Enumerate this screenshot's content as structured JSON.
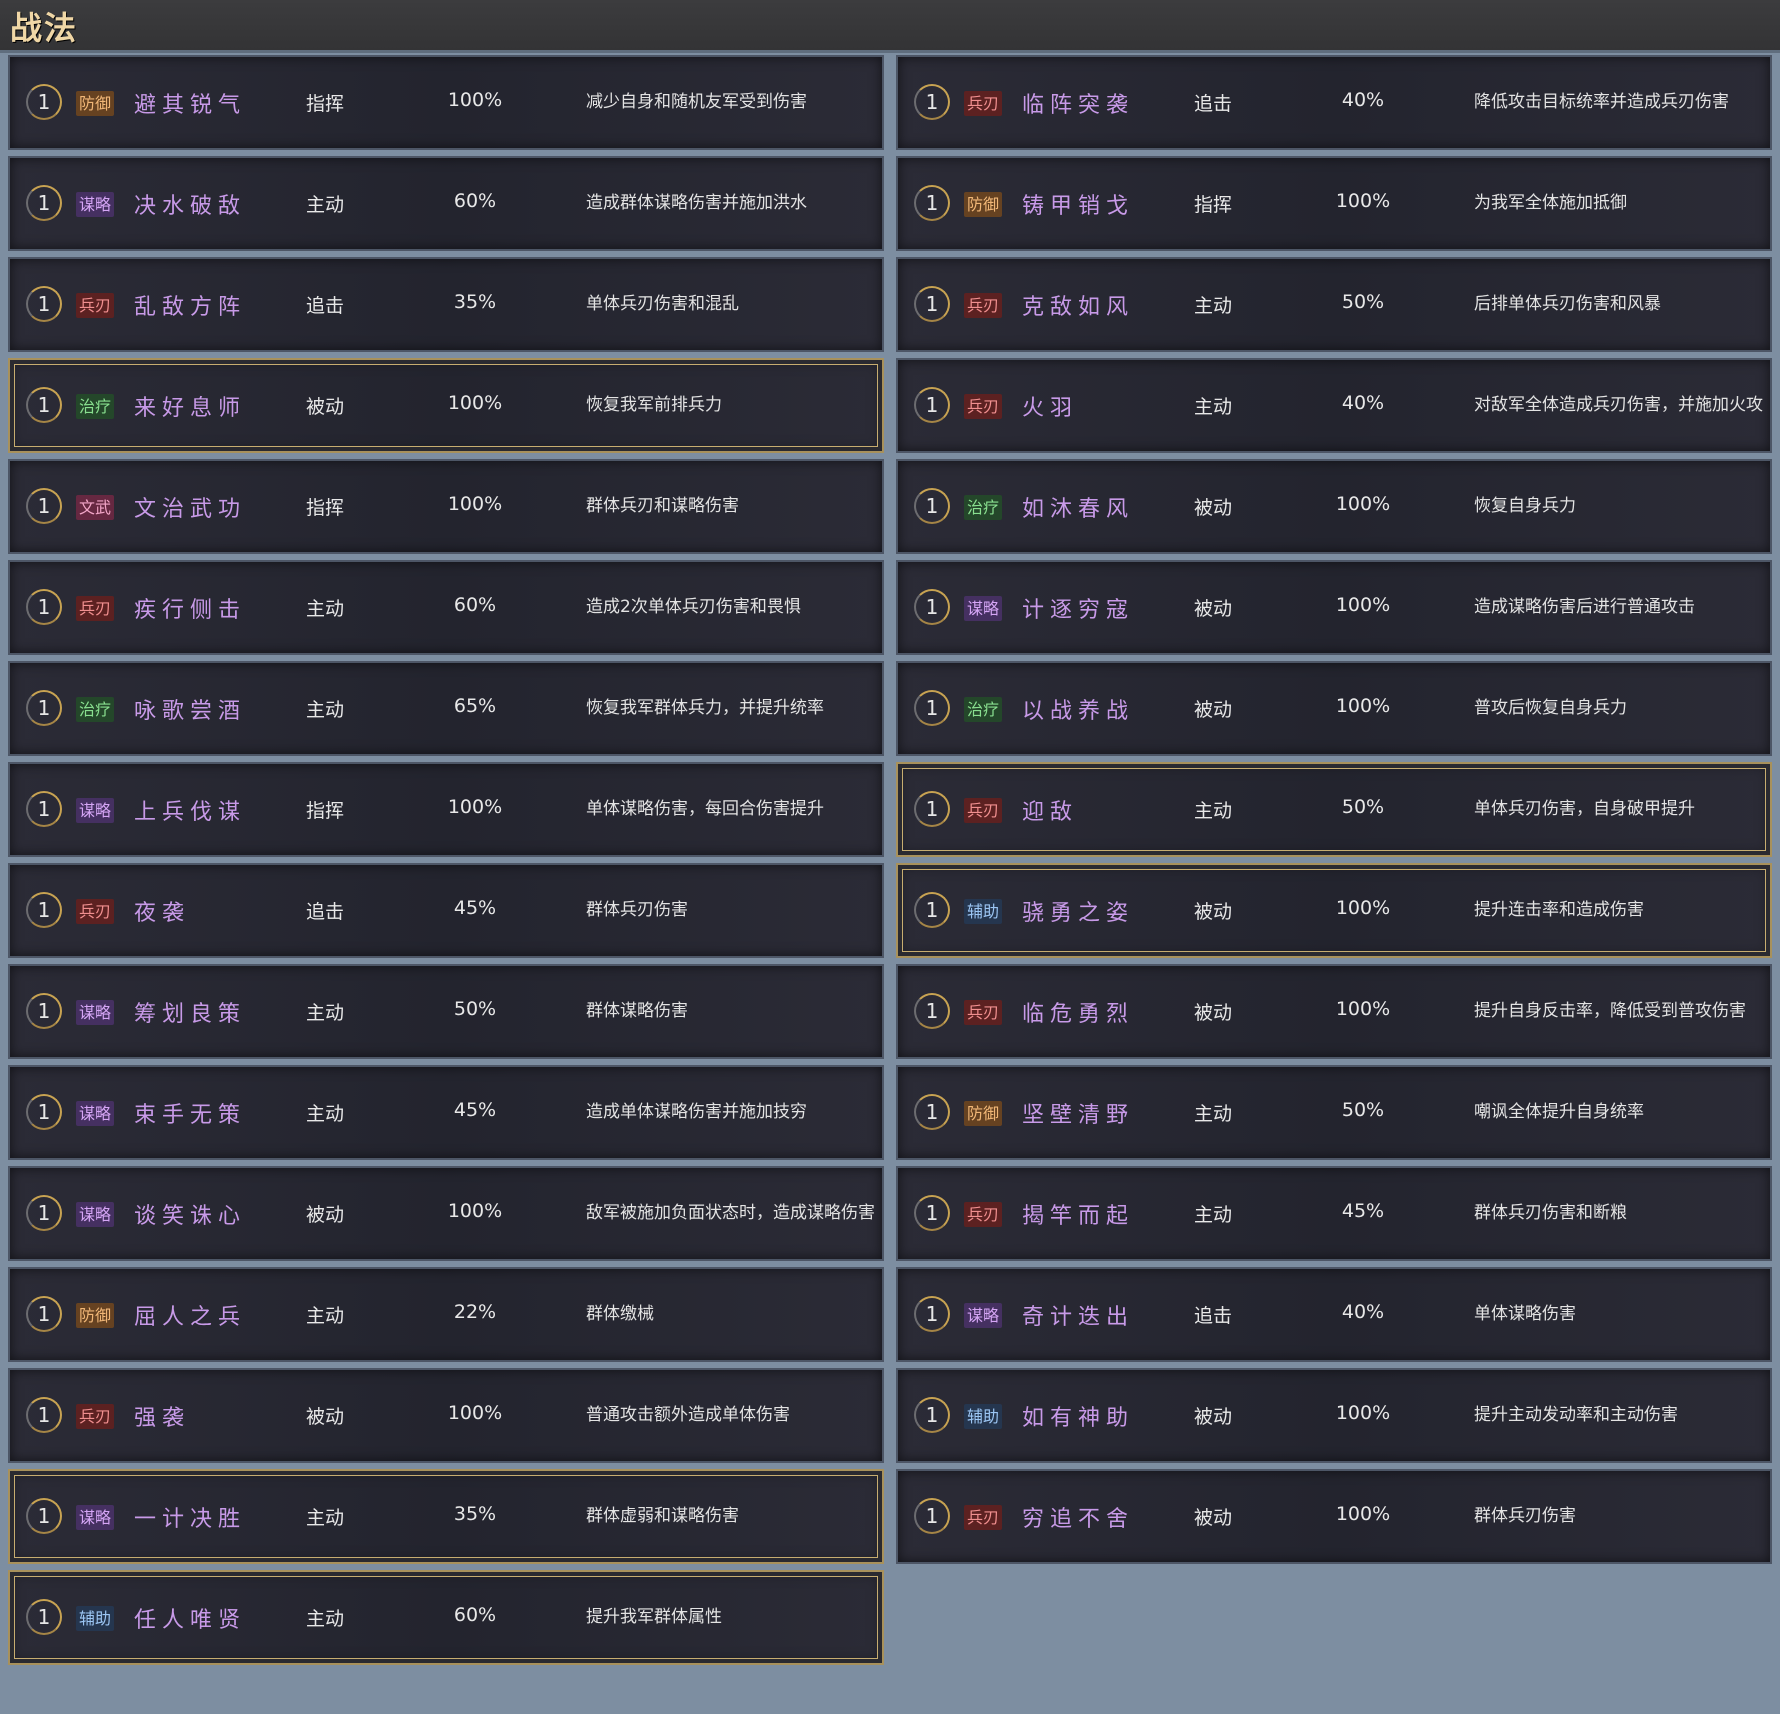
{
  "header": {
    "title": "战法"
  },
  "rows": [
    {
      "level": "1",
      "tag": "防御",
      "tag_class": "defense",
      "name": "避其锐气",
      "type": "指挥",
      "rate": "100%",
      "desc": "减少自身和随机友军受到伤害",
      "gold": false
    },
    {
      "level": "1",
      "tag": "兵刃",
      "tag_class": "weapon",
      "name": "临阵突袭",
      "type": "追击",
      "rate": "40%",
      "desc": "降低攻击目标统率并造成兵刃伤害",
      "gold": false
    },
    {
      "level": "1",
      "tag": "谋略",
      "tag_class": "strategy",
      "name": "决水破敌",
      "type": "主动",
      "rate": "60%",
      "desc": "造成群体谋略伤害并施加洪水",
      "gold": false
    },
    {
      "level": "1",
      "tag": "防御",
      "tag_class": "defense",
      "name": "铸甲销戈",
      "type": "指挥",
      "rate": "100%",
      "desc": "为我军全体施加抵御",
      "gold": false
    },
    {
      "level": "1",
      "tag": "兵刃",
      "tag_class": "weapon",
      "name": "乱敌方阵",
      "type": "追击",
      "rate": "35%",
      "desc": "单体兵刃伤害和混乱",
      "gold": false
    },
    {
      "level": "1",
      "tag": "兵刃",
      "tag_class": "weapon",
      "name": "克敌如风",
      "type": "主动",
      "rate": "50%",
      "desc": "后排单体兵刃伤害和风暴",
      "gold": false
    },
    {
      "level": "1",
      "tag": "治疗",
      "tag_class": "heal",
      "name": "来好息师",
      "type": "被动",
      "rate": "100%",
      "desc": "恢复我军前排兵力",
      "gold": true
    },
    {
      "level": "1",
      "tag": "兵刃",
      "tag_class": "weapon",
      "name": "火羽",
      "type": "主动",
      "rate": "40%",
      "desc": "对敌军全体造成兵刃伤害，并施加火攻",
      "gold": false
    },
    {
      "level": "1",
      "tag": "文武",
      "tag_class": "civmil",
      "name": "文治武功",
      "type": "指挥",
      "rate": "100%",
      "desc": "群体兵刃和谋略伤害",
      "gold": false
    },
    {
      "level": "1",
      "tag": "治疗",
      "tag_class": "heal",
      "name": "如沐春风",
      "type": "被动",
      "rate": "100%",
      "desc": "恢复自身兵力",
      "gold": false
    },
    {
      "level": "1",
      "tag": "兵刃",
      "tag_class": "weapon",
      "name": "疾行侧击",
      "type": "主动",
      "rate": "60%",
      "desc": "造成2次单体兵刃伤害和畏惧",
      "gold": false
    },
    {
      "level": "1",
      "tag": "谋略",
      "tag_class": "strategy",
      "name": "计逐穷寇",
      "type": "被动",
      "rate": "100%",
      "desc": "造成谋略伤害后进行普通攻击",
      "gold": false
    },
    {
      "level": "1",
      "tag": "治疗",
      "tag_class": "heal",
      "name": "咏歌尝酒",
      "type": "主动",
      "rate": "65%",
      "desc": "恢复我军群体兵力，并提升统率",
      "gold": false
    },
    {
      "level": "1",
      "tag": "治疗",
      "tag_class": "heal",
      "name": "以战养战",
      "type": "被动",
      "rate": "100%",
      "desc": "普攻后恢复自身兵力",
      "gold": false
    },
    {
      "level": "1",
      "tag": "谋略",
      "tag_class": "strategy",
      "name": "上兵伐谋",
      "type": "指挥",
      "rate": "100%",
      "desc": "单体谋略伤害，每回合伤害提升",
      "gold": false
    },
    {
      "level": "1",
      "tag": "兵刃",
      "tag_class": "weapon",
      "name": "迎敌",
      "type": "主动",
      "rate": "50%",
      "desc": "单体兵刃伤害，自身破甲提升",
      "gold": true
    },
    {
      "level": "1",
      "tag": "兵刃",
      "tag_class": "weapon",
      "name": "夜袭",
      "type": "追击",
      "rate": "45%",
      "desc": "群体兵刃伤害",
      "gold": false
    },
    {
      "level": "1",
      "tag": "辅助",
      "tag_class": "assist",
      "name": "骁勇之姿",
      "type": "被动",
      "rate": "100%",
      "desc": "提升连击率和造成伤害",
      "gold": true
    },
    {
      "level": "1",
      "tag": "谋略",
      "tag_class": "strategy",
      "name": "筹划良策",
      "type": "主动",
      "rate": "50%",
      "desc": "群体谋略伤害",
      "gold": false
    },
    {
      "level": "1",
      "tag": "兵刃",
      "tag_class": "weapon",
      "name": "临危勇烈",
      "type": "被动",
      "rate": "100%",
      "desc": "提升自身反击率，降低受到普攻伤害",
      "gold": false
    },
    {
      "level": "1",
      "tag": "谋略",
      "tag_class": "strategy",
      "name": "束手无策",
      "type": "主动",
      "rate": "45%",
      "desc": "造成单体谋略伤害并施加技穷",
      "gold": false
    },
    {
      "level": "1",
      "tag": "防御",
      "tag_class": "defense",
      "name": "坚壁清野",
      "type": "主动",
      "rate": "50%",
      "desc": "嘲讽全体提升自身统率",
      "gold": false
    },
    {
      "level": "1",
      "tag": "谋略",
      "tag_class": "strategy",
      "name": "谈笑诛心",
      "type": "被动",
      "rate": "100%",
      "desc": "敌军被施加负面状态时，造成谋略伤害",
      "gold": false
    },
    {
      "level": "1",
      "tag": "兵刃",
      "tag_class": "weapon",
      "name": "揭竿而起",
      "type": "主动",
      "rate": "45%",
      "desc": "群体兵刃伤害和断粮",
      "gold": false
    },
    {
      "level": "1",
      "tag": "防御",
      "tag_class": "defense",
      "name": "屈人之兵",
      "type": "主动",
      "rate": "22%",
      "desc": "群体缴械",
      "gold": false
    },
    {
      "level": "1",
      "tag": "谋略",
      "tag_class": "strategy",
      "name": "奇计迭出",
      "type": "追击",
      "rate": "40%",
      "desc": "单体谋略伤害",
      "gold": false
    },
    {
      "level": "1",
      "tag": "兵刃",
      "tag_class": "weapon",
      "name": "强袭",
      "type": "被动",
      "rate": "100%",
      "desc": "普通攻击额外造成单体伤害",
      "gold": false
    },
    {
      "level": "1",
      "tag": "辅助",
      "tag_class": "assist",
      "name": "如有神助",
      "type": "被动",
      "rate": "100%",
      "desc": "提升主动发动率和主动伤害",
      "gold": false
    },
    {
      "level": "1",
      "tag": "谋略",
      "tag_class": "strategy",
      "name": "一计决胜",
      "type": "主动",
      "rate": "35%",
      "desc": "群体虚弱和谋略伤害",
      "gold": true
    },
    {
      "level": "1",
      "tag": "兵刃",
      "tag_class": "weapon",
      "name": "穷追不舍",
      "type": "被动",
      "rate": "100%",
      "desc": "群体兵刃伤害",
      "gold": false
    },
    {
      "level": "1",
      "tag": "辅助",
      "tag_class": "assist",
      "name": "任人唯贤",
      "type": "主动",
      "rate": "60%",
      "desc": "提升我军群体属性",
      "gold": true
    }
  ]
}
